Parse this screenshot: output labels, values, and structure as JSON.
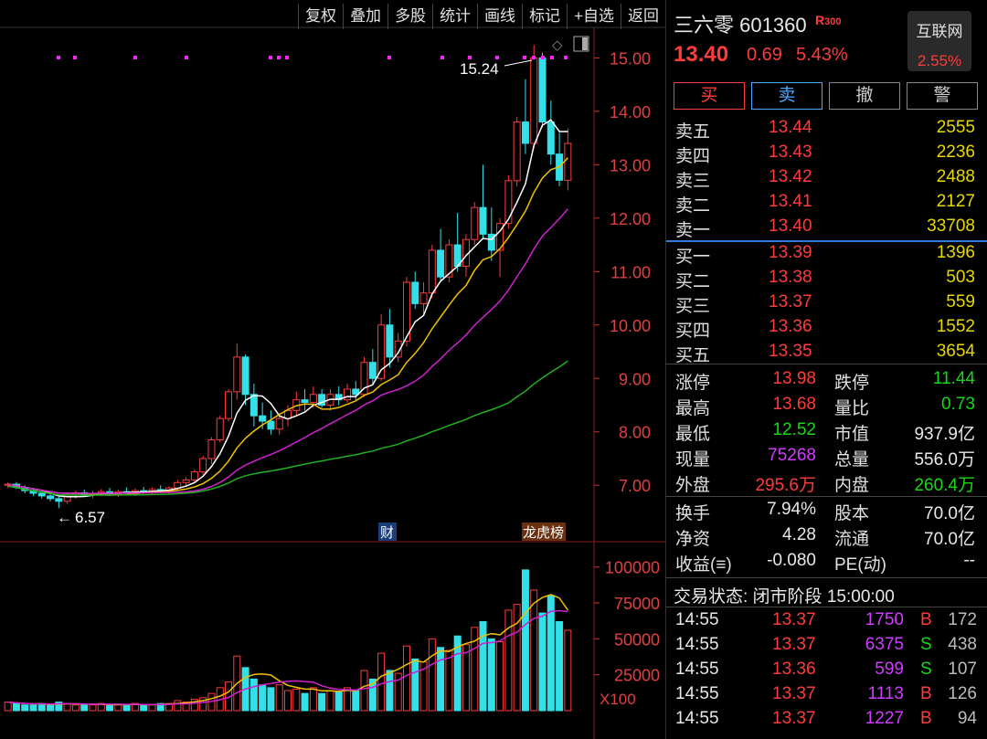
{
  "toolbar": [
    "复权",
    "叠加",
    "多股",
    "统计",
    "画线",
    "标记",
    "+自选",
    "返回"
  ],
  "stock": {
    "name": "三六零",
    "code": "601360",
    "badge": "R",
    "badge_sub": "300",
    "price": "13.40",
    "change": "0.69",
    "pct": "5.43%",
    "sector": "互联网",
    "sector_pct": "2.55%"
  },
  "actions": {
    "buy": "买",
    "sell": "卖",
    "cancel": "撤",
    "alert": "警"
  },
  "asks": [
    {
      "label": "卖五",
      "price": "13.44",
      "vol": "2555"
    },
    {
      "label": "卖四",
      "price": "13.43",
      "vol": "2236"
    },
    {
      "label": "卖三",
      "price": "13.42",
      "vol": "2488"
    },
    {
      "label": "卖二",
      "price": "13.41",
      "vol": "2127"
    },
    {
      "label": "卖一",
      "price": "13.40",
      "vol": "33708"
    }
  ],
  "bids": [
    {
      "label": "买一",
      "price": "13.39",
      "vol": "1396"
    },
    {
      "label": "买二",
      "price": "13.38",
      "vol": "503"
    },
    {
      "label": "买三",
      "price": "13.37",
      "vol": "559"
    },
    {
      "label": "买四",
      "price": "13.36",
      "vol": "1552"
    },
    {
      "label": "买五",
      "price": "13.35",
      "vol": "3654"
    }
  ],
  "stats": [
    {
      "l1": "涨停",
      "v1": "13.98",
      "c1": "red",
      "l2": "跌停",
      "v2": "11.44",
      "c2": "grn"
    },
    {
      "l1": "最高",
      "v1": "13.68",
      "c1": "red",
      "l2": "量比",
      "v2": "0.73",
      "c2": "grn"
    },
    {
      "l1": "最低",
      "v1": "12.52",
      "c1": "grn",
      "l2": "市值",
      "v2": "937.9亿",
      "c2": "wht"
    },
    {
      "l1": "现量",
      "v1": "75268",
      "c1": "mag",
      "l2": "总量",
      "v2": "556.0万",
      "c2": "wht"
    },
    {
      "l1": "外盘",
      "v1": "295.6万",
      "c1": "red",
      "l2": "内盘",
      "v2": "260.4万",
      "c2": "grn"
    }
  ],
  "stats2": [
    {
      "l1": "换手",
      "v1": "7.94%",
      "l2": "股本",
      "v2": "70.0亿"
    },
    {
      "l1": "净资",
      "v1": "4.28",
      "l2": "流通",
      "v2": "70.0亿"
    },
    {
      "l1": "收益(≡)",
      "v1": "-0.080",
      "l2": "PE(动)",
      "v2": "--"
    }
  ],
  "trade_status": "交易状态: 闭市阶段 15:00:00",
  "ticks": [
    {
      "t": "14:55",
      "p": "13.37",
      "v": "1750",
      "s": "B",
      "n": "172"
    },
    {
      "t": "14:55",
      "p": "13.37",
      "v": "6375",
      "s": "S",
      "n": "438"
    },
    {
      "t": "14:55",
      "p": "13.36",
      "v": "599",
      "s": "S",
      "n": "107"
    },
    {
      "t": "14:55",
      "p": "13.37",
      "v": "1113",
      "s": "B",
      "n": "126"
    },
    {
      "t": "14:55",
      "p": "13.37",
      "v": "1227",
      "s": "B",
      "n": "94"
    }
  ],
  "chart_data": {
    "type": "candlestick",
    "price_ticks": [
      "15.00",
      "14.00",
      "13.00",
      "12.00",
      "11.00",
      "10.00",
      "9.00",
      "8.00",
      "7.00"
    ],
    "vol_ticks": [
      "100000",
      "75000",
      "50000",
      "25000"
    ],
    "vol_unit": "X100",
    "annotations": {
      "high": "15.24",
      "low": "6.57",
      "fin": "财",
      "rank": "龙虎榜"
    },
    "ylim": [
      6.2,
      15.4
    ],
    "candles": [
      [
        7.0,
        7.05,
        6.95,
        7.02
      ],
      [
        7.02,
        7.06,
        6.93,
        6.96
      ],
      [
        6.96,
        7.0,
        6.85,
        6.9
      ],
      [
        6.9,
        6.95,
        6.8,
        6.85
      ],
      [
        6.85,
        6.92,
        6.75,
        6.8
      ],
      [
        6.8,
        6.88,
        6.7,
        6.75
      ],
      [
        6.75,
        6.82,
        6.57,
        6.7
      ],
      [
        6.7,
        6.86,
        6.65,
        6.82
      ],
      [
        6.82,
        6.9,
        6.75,
        6.86
      ],
      [
        6.86,
        6.92,
        6.78,
        6.82
      ],
      [
        6.82,
        6.9,
        6.76,
        6.85
      ],
      [
        6.85,
        6.93,
        6.8,
        6.88
      ],
      [
        6.88,
        6.95,
        6.8,
        6.84
      ],
      [
        6.84,
        6.92,
        6.78,
        6.88
      ],
      [
        6.88,
        6.96,
        6.82,
        6.86
      ],
      [
        6.86,
        6.94,
        6.8,
        6.9
      ],
      [
        6.9,
        6.97,
        6.84,
        6.88
      ],
      [
        6.88,
        6.96,
        6.82,
        6.92
      ],
      [
        6.92,
        7.0,
        6.86,
        6.9
      ],
      [
        6.9,
        6.98,
        6.84,
        6.95
      ],
      [
        6.95,
        7.1,
        6.9,
        7.05
      ],
      [
        7.05,
        7.15,
        6.98,
        7.1
      ],
      [
        7.1,
        7.3,
        7.05,
        7.25
      ],
      [
        7.25,
        7.55,
        7.2,
        7.5
      ],
      [
        7.5,
        7.9,
        7.4,
        7.85
      ],
      [
        7.85,
        8.3,
        7.8,
        8.25
      ],
      [
        8.25,
        8.8,
        8.2,
        8.75
      ],
      [
        8.75,
        9.65,
        8.6,
        9.4
      ],
      [
        9.4,
        9.45,
        8.5,
        8.7
      ],
      [
        8.7,
        8.9,
        8.1,
        8.3
      ],
      [
        8.3,
        8.55,
        8.05,
        8.2
      ],
      [
        8.2,
        8.4,
        7.95,
        8.05
      ],
      [
        8.05,
        8.35,
        7.95,
        8.25
      ],
      [
        8.25,
        8.5,
        8.1,
        8.4
      ],
      [
        8.4,
        8.75,
        8.3,
        8.6
      ],
      [
        8.6,
        8.8,
        8.4,
        8.55
      ],
      [
        8.55,
        8.85,
        8.45,
        8.7
      ],
      [
        8.7,
        8.8,
        8.45,
        8.5
      ],
      [
        8.5,
        8.8,
        8.4,
        8.7
      ],
      [
        8.7,
        8.85,
        8.5,
        8.6
      ],
      [
        8.6,
        8.9,
        8.55,
        8.8
      ],
      [
        8.8,
        8.95,
        8.6,
        8.7
      ],
      [
        8.7,
        9.4,
        8.65,
        9.3
      ],
      [
        9.3,
        9.55,
        8.9,
        9.0
      ],
      [
        9.0,
        10.2,
        8.95,
        10.0
      ],
      [
        10.0,
        10.3,
        9.2,
        9.4
      ],
      [
        9.4,
        9.85,
        9.3,
        9.7
      ],
      [
        9.7,
        10.9,
        9.6,
        10.8
      ],
      [
        10.8,
        11.0,
        10.3,
        10.4
      ],
      [
        10.4,
        10.8,
        10.2,
        10.6
      ],
      [
        10.6,
        11.5,
        10.5,
        11.4
      ],
      [
        11.4,
        11.8,
        10.8,
        10.9
      ],
      [
        10.9,
        11.6,
        10.8,
        11.5
      ],
      [
        11.5,
        12.1,
        11.0,
        11.1
      ],
      [
        11.1,
        11.7,
        10.9,
        11.6
      ],
      [
        11.6,
        12.3,
        11.5,
        12.2
      ],
      [
        12.2,
        13.0,
        11.6,
        11.7
      ],
      [
        11.7,
        12.2,
        11.2,
        11.4
      ],
      [
        11.4,
        12.0,
        10.9,
        11.9
      ],
      [
        11.9,
        12.8,
        11.8,
        12.7
      ],
      [
        12.7,
        13.9,
        12.6,
        13.8
      ],
      [
        13.8,
        14.6,
        13.2,
        13.4
      ],
      [
        13.4,
        15.24,
        13.3,
        15.0
      ],
      [
        15.0,
        15.1,
        13.7,
        13.8
      ],
      [
        13.8,
        14.2,
        13.0,
        13.2
      ],
      [
        13.2,
        13.6,
        12.6,
        12.71
      ],
      [
        12.71,
        13.68,
        12.52,
        13.4
      ]
    ],
    "volumes": [
      6,
      5,
      4,
      4,
      5,
      4,
      6,
      5,
      4,
      4,
      4,
      5,
      4,
      4,
      4,
      5,
      4,
      4,
      5,
      5,
      7,
      6,
      8,
      9,
      12,
      16,
      20,
      38,
      30,
      22,
      18,
      16,
      18,
      14,
      15,
      12,
      16,
      12,
      14,
      13,
      16,
      14,
      28,
      22,
      40,
      28,
      26,
      45,
      36,
      34,
      50,
      44,
      42,
      52,
      46,
      58,
      62,
      50,
      48,
      70,
      74,
      98,
      84,
      68,
      80,
      62,
      56
    ],
    "ma5_end": 13.78,
    "ma10_end": 13.05,
    "ma20_end": 12.0,
    "ma60_end": 9.22
  }
}
